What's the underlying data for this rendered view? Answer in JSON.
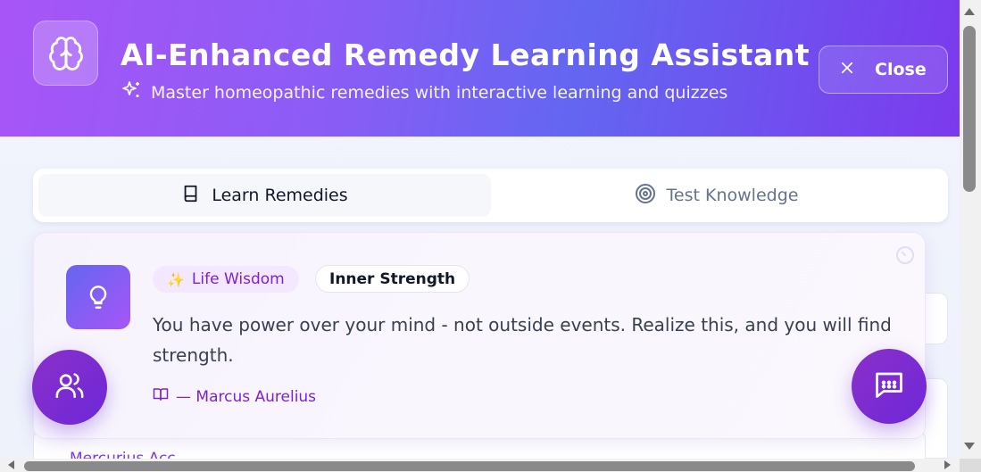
{
  "header": {
    "title": "AI-Enhanced Remedy Learning Assistant",
    "subtitle": "Master homeopathic remedies with interactive learning and quizzes",
    "close_label": "Close"
  },
  "tabs": [
    {
      "label": "Learn Remedies",
      "icon": "book-icon",
      "active": true
    },
    {
      "label": "Test Knowledge",
      "icon": "target-icon",
      "active": false
    }
  ],
  "quote_card": {
    "badge_primary": "Life Wisdom",
    "badge_secondary": "Inner Strength",
    "quote": "You have power over your mind - not outside events. Realize this, and you will find strength.",
    "author": "— Marcus Aurelius",
    "icon": "lightbulb-icon"
  },
  "peek_text": "Mercurius Acc...",
  "colors": {
    "header_gradient_start": "#a855f7",
    "header_gradient_mid": "#6366f1",
    "accent_purple": "#7e22ce",
    "fab": "#7c3aed"
  }
}
